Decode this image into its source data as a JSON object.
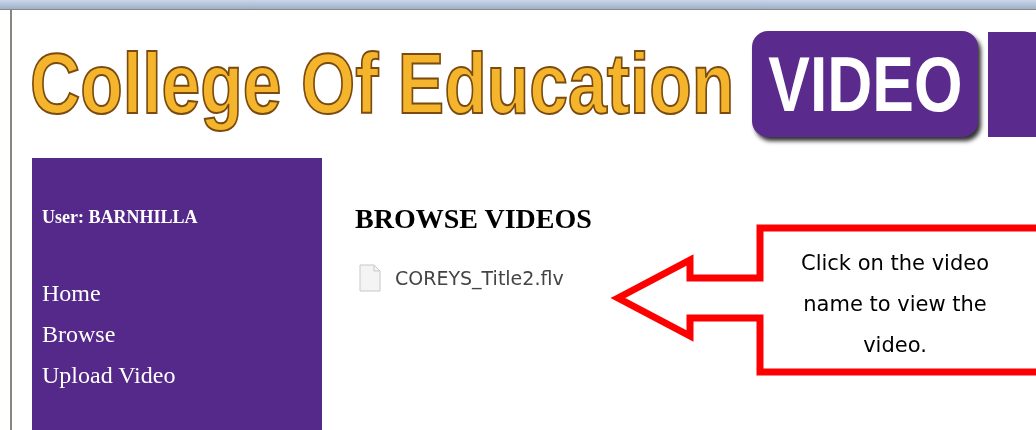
{
  "banner": {
    "title": "College Of Education",
    "badge": "VIDEO"
  },
  "sidebar": {
    "user": "User: BARNHILLA",
    "items": [
      "Home",
      "Browse",
      "Upload Video"
    ]
  },
  "main": {
    "heading": "BROWSE VIDEOS",
    "files": [
      "COREYS_Title2.flv"
    ]
  },
  "callout": {
    "text": "Click on the video name to view the video."
  }
}
